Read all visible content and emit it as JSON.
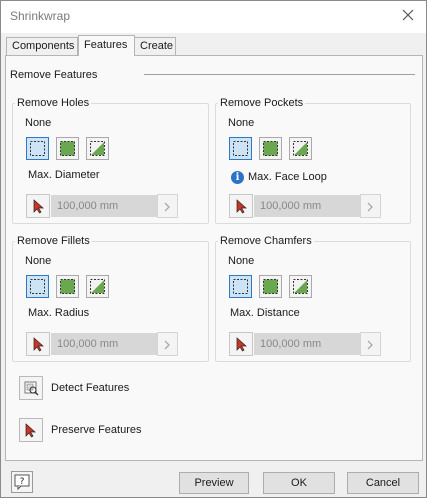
{
  "window": {
    "title": "Shrinkwrap",
    "close_icon": "close-icon"
  },
  "tabs": [
    {
      "label": "Components",
      "active": false
    },
    {
      "label": "Features",
      "active": true
    },
    {
      "label": "Create",
      "active": false
    }
  ],
  "remove_features": {
    "title": "Remove Features",
    "holes": {
      "title": "Remove Holes",
      "selection": "None",
      "max_label": "Max. Diameter",
      "value": "100,000 mm"
    },
    "pockets": {
      "title": "Remove Pockets",
      "selection": "None",
      "max_label": "Max. Face Loop",
      "value": "100,000 mm"
    },
    "fillets": {
      "title": "Remove Fillets",
      "selection": "None",
      "max_label": "Max. Radius",
      "value": "100,000 mm"
    },
    "chamfers": {
      "title": "Remove Chamfers",
      "selection": "None",
      "max_label": "Max. Distance",
      "value": "100,000 mm"
    }
  },
  "actions": {
    "detect_label": "Detect Features",
    "preserve_label": "Preserve Features"
  },
  "footer": {
    "preview_label": "Preview",
    "ok_label": "OK",
    "cancel_label": "Cancel"
  },
  "colors": {
    "selected_border": "#2e79c4",
    "selected_fill": "#cde3f6",
    "feature_green": "#6aa84f",
    "cursor_red": "#c0392b",
    "info_blue": "#2b73c4"
  }
}
